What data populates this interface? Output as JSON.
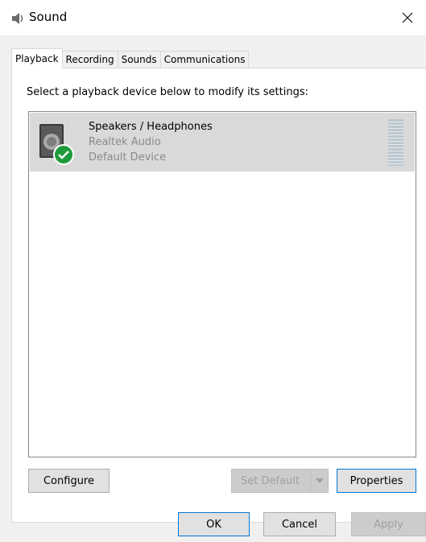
{
  "window": {
    "title": "Sound",
    "title_icon": "speaker-icon",
    "close_glyph": "✕"
  },
  "tabs": [
    {
      "label": "Playback",
      "active": true
    },
    {
      "label": "Recording",
      "active": false
    },
    {
      "label": "Sounds",
      "active": false
    },
    {
      "label": "Communications",
      "active": false
    }
  ],
  "playback": {
    "instruction": "Select a playback device below to modify its settings:",
    "devices": [
      {
        "name": "Speakers / Headphones",
        "driver": "Realtek Audio",
        "status": "Default Device",
        "icon": "speaker-device-icon",
        "badge": "default-check-icon",
        "selected": true
      }
    ],
    "buttons": {
      "configure": "Configure",
      "set_default": "Set Default",
      "properties": "Properties"
    }
  },
  "dialog_buttons": {
    "ok": "OK",
    "cancel": "Cancel",
    "apply": "Apply"
  },
  "colors": {
    "selection": "#d9d9d9",
    "focus_border": "#0078d7",
    "check_badge": "#1f9a3a"
  }
}
